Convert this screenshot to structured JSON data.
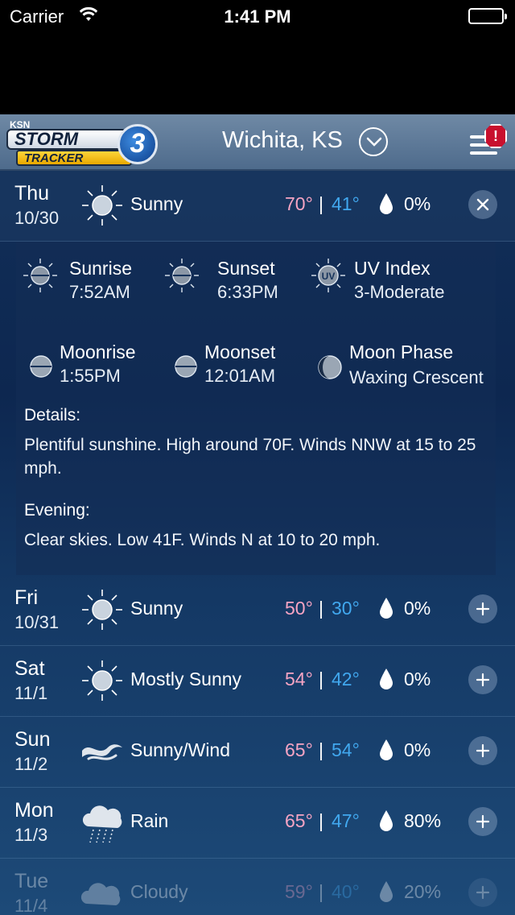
{
  "status_bar": {
    "carrier": "Carrier",
    "time": "1:41 PM"
  },
  "header": {
    "logo": {
      "ksn": "KSN",
      "storm": "STORM",
      "tracker": "TRACKER",
      "channel": "3"
    },
    "location": "Wichita, KS",
    "alert_symbol": "!"
  },
  "forecast": [
    {
      "day": "Thu",
      "date": "10/30",
      "icon": "sun-icon",
      "condition": "Sunny",
      "high": "70°",
      "low": "41°",
      "precip": "0%",
      "action": "close",
      "expanded": true
    },
    {
      "day": "Fri",
      "date": "10/31",
      "icon": "sun-icon",
      "condition": "Sunny",
      "high": "50°",
      "low": "30°",
      "precip": "0%",
      "action": "expand"
    },
    {
      "day": "Sat",
      "date": "11/1",
      "icon": "sun-icon",
      "condition": "Mostly Sunny",
      "high": "54°",
      "low": "42°",
      "precip": "0%",
      "action": "expand"
    },
    {
      "day": "Sun",
      "date": "11/2",
      "icon": "wind-icon",
      "condition": "Sunny/Wind",
      "high": "65°",
      "low": "54°",
      "precip": "0%",
      "action": "expand"
    },
    {
      "day": "Mon",
      "date": "11/3",
      "icon": "rain-cloud-icon",
      "condition": "Rain",
      "high": "65°",
      "low": "47°",
      "precip": "80%",
      "action": "expand"
    },
    {
      "day": "Tue",
      "date": "11/4",
      "icon": "cloud-icon",
      "condition": "Cloudy",
      "high": "59°",
      "low": "40°",
      "precip": "20%",
      "action": "expand"
    }
  ],
  "details": {
    "sunrise": {
      "label": "Sunrise",
      "value": "7:52AM"
    },
    "sunset": {
      "label": "Sunset",
      "value": "6:33PM"
    },
    "uv": {
      "label": "UV Index",
      "value": "3-Moderate",
      "icon_text": "UV"
    },
    "moonrise": {
      "label": "Moonrise",
      "value": "1:55PM"
    },
    "moonset": {
      "label": "Moonset",
      "value": "12:01AM"
    },
    "moon_phase": {
      "label": "Moon Phase",
      "value": "Waxing Crescent"
    },
    "details_heading": "Details:",
    "details_text": "Plentiful sunshine. High around 70F. Winds NNW at 15 to 25 mph.",
    "evening_heading": "Evening:",
    "evening_text": "Clear skies. Low 41F. Winds N at 10 to 20 mph."
  },
  "colors": {
    "high_temp": "#f6a4c3",
    "low_temp": "#41a8ef",
    "alert": "#c8102e"
  }
}
